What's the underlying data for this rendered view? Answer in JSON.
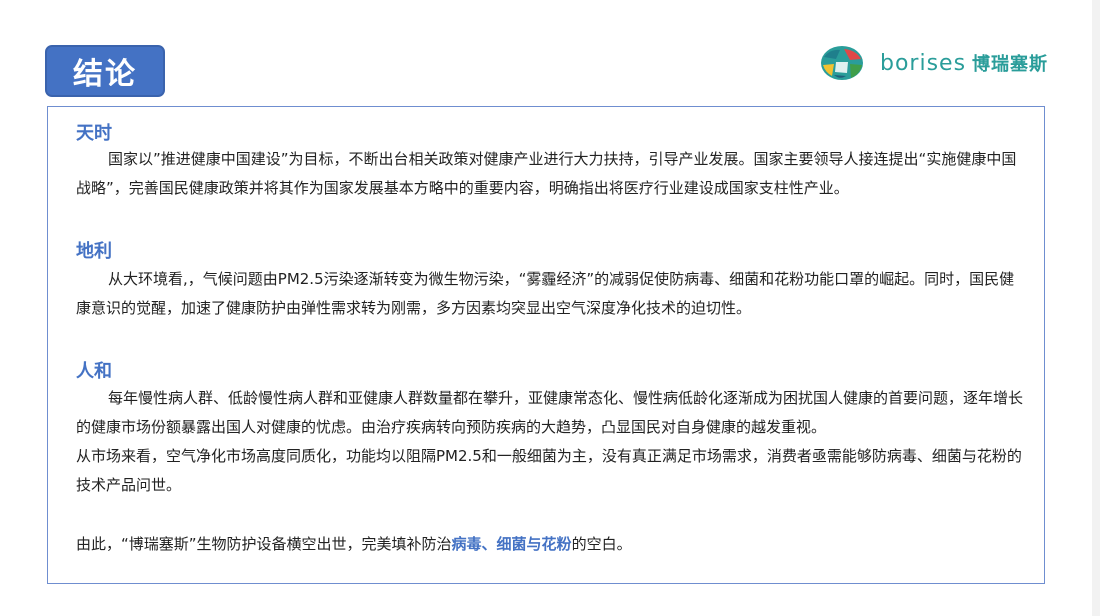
{
  "header": {
    "title": "结论",
    "logo_word": "borises",
    "logo_cn": "博瑞塞斯"
  },
  "sections": [
    {
      "heading": "天时",
      "paragraph": "国家以”推进健康中国建设”为目标，不断出台相关政策对健康产业进行大力扶持，引导产业发展。国家主要领导人接连提出“实施健康中国战略”，完善国民健康政策并将其作为国家发展基本方略中的重要内容，明确指出将医疗行业建设成国家支柱性产业。"
    },
    {
      "heading": "地利",
      "paragraph": "从大环境看,，气候问题由PM2.5污染逐渐转变为微生物污染，“雾霾经济”的减弱促使防病毒、细菌和花粉功能口罩的崛起。同时，国民健康意识的觉醒，加速了健康防护由弹性需求转为刚需，多方因素均突显出空气深度净化技术的迫切性。"
    },
    {
      "heading": "人和",
      "paragraph": "每年慢性病人群、低龄慢性病人群和亚健康人群数量都在攀升，亚健康常态化、慢性病低龄化逐渐成为困扰国人健康的首要问题，逐年增长的健康市场份额暴露出国人对健康的忧虑。由治疗疾病转向预防疾病的大趋势，凸显国民对自身健康的越发重视。",
      "paragraph2": "从市场来看，空气净化市场高度同质化，功能均以阻隔PM2.5和一般细菌为主，没有真正满足市场需求，消费者亟需能够防病毒、细菌与花粉的技术产品问世。"
    }
  ],
  "conclusion": {
    "prefix": "由此，“博瑞塞斯”生物防护设备横空出世，完美填补防治",
    "highlight": "病毒、细菌与花粉",
    "suffix": "的空白。"
  },
  "colors": {
    "accent": "#4472c4",
    "logo_teal": "#2a9d9a",
    "text": "#222222"
  }
}
